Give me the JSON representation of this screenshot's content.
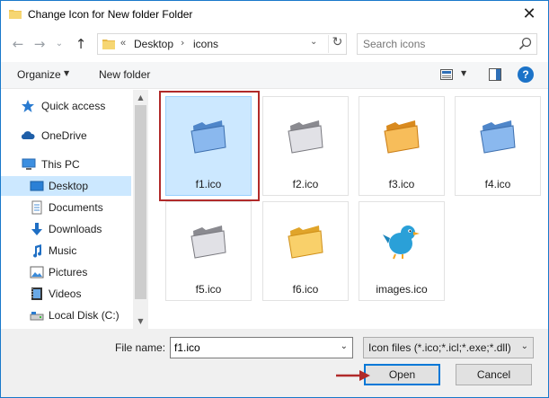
{
  "window": {
    "title": "Change Icon for New folder Folder",
    "close_glyph": "✕"
  },
  "nav": {
    "back_glyph": "←",
    "forward_glyph": "→",
    "recent_glyph": "⌄",
    "up_glyph": "↑"
  },
  "address": {
    "overflow_glyph": "«",
    "crumbs": [
      "Desktop",
      "icons"
    ],
    "separator": "›",
    "dropdown_glyph": "⌄",
    "refresh_glyph": "↻"
  },
  "search": {
    "placeholder": "Search icons"
  },
  "toolbar": {
    "organize_label": "Organize",
    "organize_dd": "▼",
    "new_folder_label": "New folder",
    "view_dd": "▼",
    "help_glyph": "?"
  },
  "sidebar": {
    "items": [
      {
        "label": "Quick access",
        "icon": "star-icon"
      },
      {
        "label": "OneDrive",
        "icon": "cloud-icon"
      },
      {
        "label": "This PC",
        "icon": "computer-icon"
      },
      {
        "label": "Desktop",
        "icon": "desktop-icon",
        "selected": true
      },
      {
        "label": "Documents",
        "icon": "documents-icon"
      },
      {
        "label": "Downloads",
        "icon": "download-icon"
      },
      {
        "label": "Music",
        "icon": "music-icon"
      },
      {
        "label": "Pictures",
        "icon": "pictures-icon"
      },
      {
        "label": "Videos",
        "icon": "videos-icon"
      },
      {
        "label": "Local Disk (C:)",
        "icon": "disk-icon"
      }
    ],
    "scroll_up_glyph": "▲",
    "scroll_down_glyph": "▼"
  },
  "files": [
    {
      "name": "f1.ico",
      "color": "#6fa3e0",
      "selected": true
    },
    {
      "name": "f2.ico",
      "color": "#c9c9cd"
    },
    {
      "name": "f3.ico",
      "color": "#f2a93b"
    },
    {
      "name": "f4.ico",
      "color": "#6fa3e0"
    },
    {
      "name": "f5.ico",
      "color": "#c9c9cd"
    },
    {
      "name": "f6.ico",
      "color": "#f4c04a"
    },
    {
      "name": "images.ico",
      "color": "#2aa0d8"
    }
  ],
  "bottom": {
    "file_name_label": "File name:",
    "file_name_value": "f1.ico",
    "file_type_value": "Icon files (*.ico;*.icl;*.exe;*.dll)",
    "dd_glyph": "⌄",
    "open_label": "Open",
    "cancel_label": "Cancel"
  },
  "colors": {
    "accent": "#0078d7",
    "selection": "#cce8ff",
    "highlight_box": "#b12a2a"
  }
}
